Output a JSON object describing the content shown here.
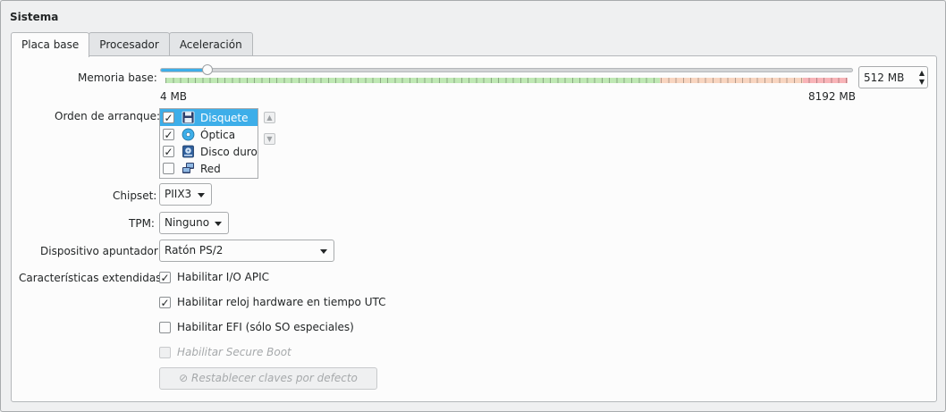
{
  "section_title": "Sistema",
  "tabs": [
    {
      "label": "Placa base",
      "active": true
    },
    {
      "label": "Procesador",
      "active": false
    },
    {
      "label": "Aceleración",
      "active": false
    }
  ],
  "memory": {
    "label": "Memoria base:",
    "min_label": "4 MB",
    "max_label": "8192 MB",
    "value": "512 MB",
    "min_mb": 4,
    "max_mb": 8192,
    "current_mb": 512,
    "zones": {
      "green_end_mb": 5940,
      "orange_end_mb": 7660
    }
  },
  "boot": {
    "label": "Orden de arranque:",
    "items": [
      {
        "label": "Disquete",
        "checked": true,
        "selected": true,
        "icon": "floppy-icon"
      },
      {
        "label": "Óptica",
        "checked": true,
        "selected": false,
        "icon": "optical-disc-icon"
      },
      {
        "label": "Disco duro",
        "checked": true,
        "selected": false,
        "icon": "hard-disk-icon"
      },
      {
        "label": "Red",
        "checked": false,
        "selected": false,
        "icon": "network-icon"
      }
    ]
  },
  "chipset": {
    "label": "Chipset:",
    "value": "PIIX3"
  },
  "tpm": {
    "label": "TPM:",
    "value": "Ninguno"
  },
  "pointing": {
    "label": "Dispositivo apuntador:",
    "value": "Ratón PS/2"
  },
  "extended": {
    "label": "Características extendidas:",
    "ioapic": "Habilitar I/O APIC",
    "utc": "Habilitar reloj hardware en tiempo UTC",
    "efi": "Habilitar EFI (sólo SO especiales)",
    "secure_boot": "Habilitar Secure Boot",
    "reset_keys": "Restablecer claves por defecto"
  },
  "colors": {
    "accent": "#3daee9"
  }
}
